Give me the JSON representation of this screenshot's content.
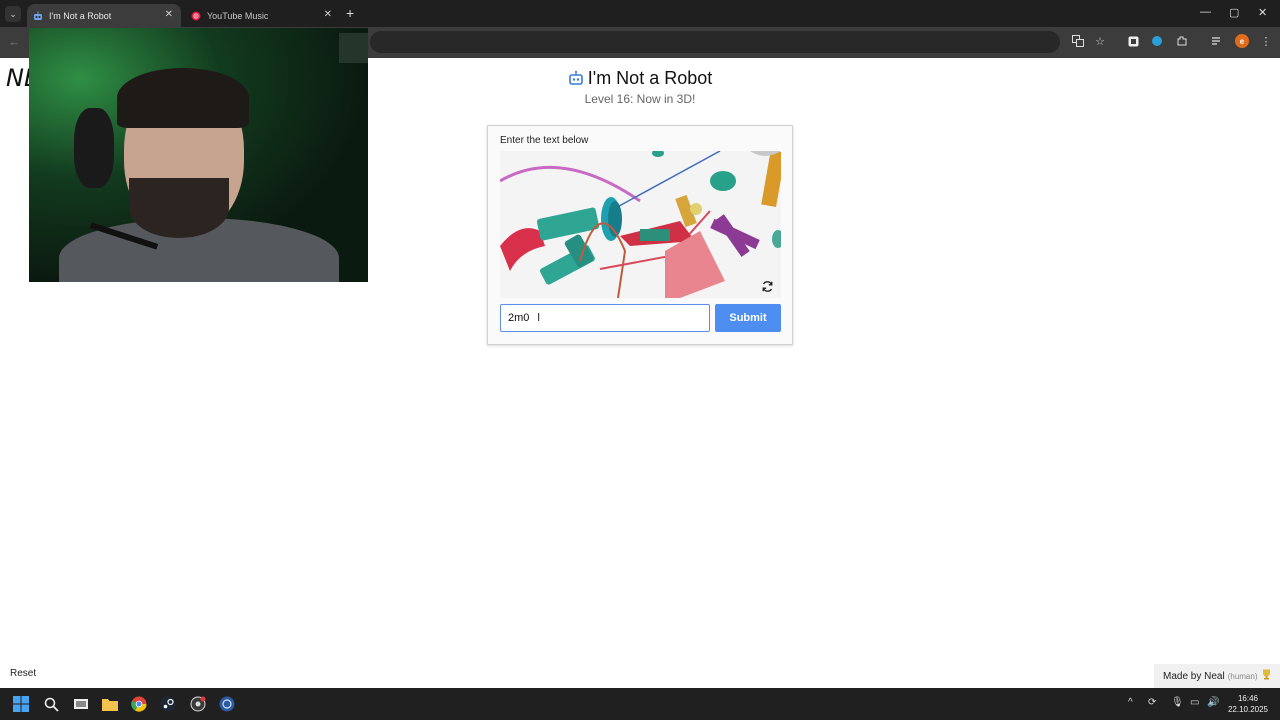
{
  "browser": {
    "tabs": [
      {
        "title": "I'm Not a Robot",
        "active": true
      },
      {
        "title": "YouTube Music",
        "active": false
      }
    ],
    "new_tab_symbol": "+",
    "close_symbol": "✕",
    "back_symbol": "←",
    "window_controls": {
      "minimize": "—",
      "maximize": "▢",
      "close": "✕"
    }
  },
  "overlay": {
    "webcam_side_text": "NE"
  },
  "page": {
    "title": "I'm Not a Robot",
    "subtitle": "Level 16: Now in 3D!",
    "captcha": {
      "label": "Enter the text below",
      "input_value": "2m0",
      "submit_label": "Submit"
    },
    "footer": {
      "reset_label": "Reset",
      "made_by": "Made by Neal",
      "made_by_note": "(human)"
    }
  },
  "taskbar": {
    "clock_time": "16:46",
    "clock_date": "22.10.2025"
  },
  "colors": {
    "accent": "#4d8ef0",
    "youtube_music": "#e5173f",
    "chrome_dark": "#1f1f1f"
  },
  "icons": [
    "robot-icon",
    "refresh-icon",
    "trophy-icon",
    "windows-start-icon",
    "search-icon",
    "chrome-icon",
    "steam-icon"
  ]
}
